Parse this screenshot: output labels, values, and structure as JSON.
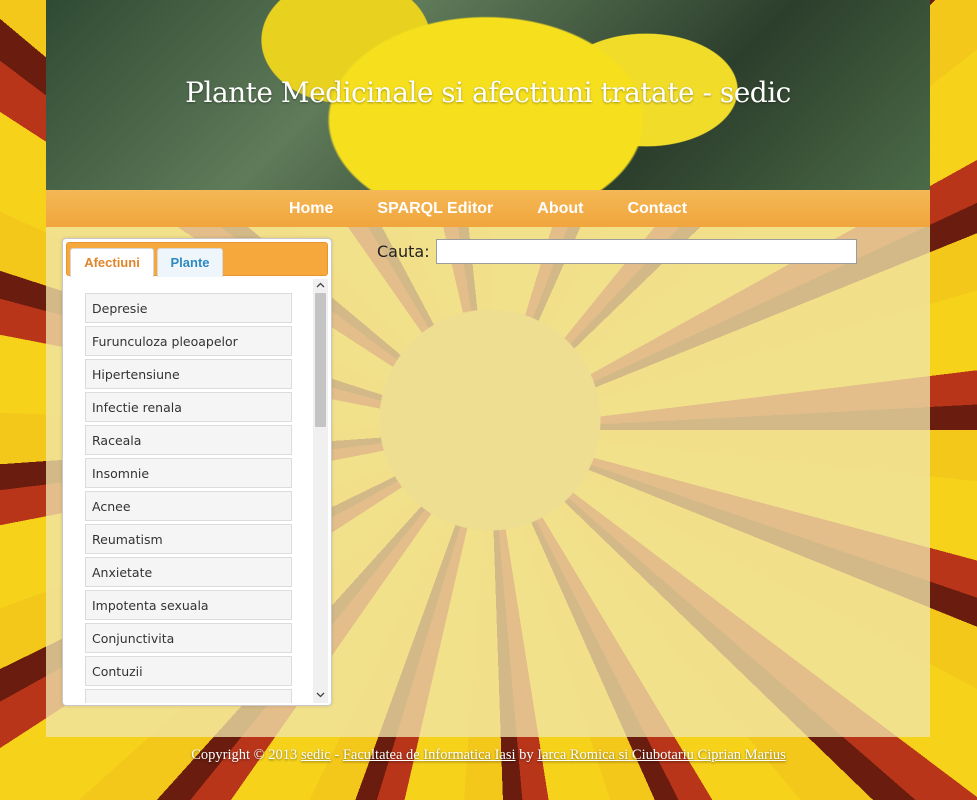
{
  "header": {
    "title": "Plante Medicinale si afectiuni tratate - sedic"
  },
  "nav": {
    "items": [
      "Home",
      "SPARQL Editor",
      "About",
      "Contact"
    ]
  },
  "tabs": {
    "items": [
      "Afectiuni",
      "Plante"
    ],
    "active": "Afectiuni"
  },
  "afectiuni": [
    "Depresie",
    "Furunculoza pleoapelor",
    "Hipertensiune",
    "Infectie renala",
    "Raceala",
    "Insomnie",
    "Acnee",
    "Reumatism",
    "Anxietate",
    "Impotenta sexuala",
    "Conjunctivita",
    "Contuzii"
  ],
  "search": {
    "label": "Cauta:",
    "value": ""
  },
  "footer": {
    "prefix": "Copyright © 2013",
    "link1": "sedic",
    "sep": "-",
    "link2": "Facultatea de Informatica Iasi",
    "by": "by",
    "link3": "Iarca Romica si Ciubotariu Ciprian Marius"
  },
  "colors": {
    "nav_bar": "#f1a53c",
    "tab_active_text": "#e0852b",
    "tab_inactive_text": "#2e89c1",
    "content_overlay": "#f1e6aa"
  },
  "icons": {
    "scroll_up": "chevron-up-icon",
    "scroll_down": "chevron-down-icon"
  }
}
